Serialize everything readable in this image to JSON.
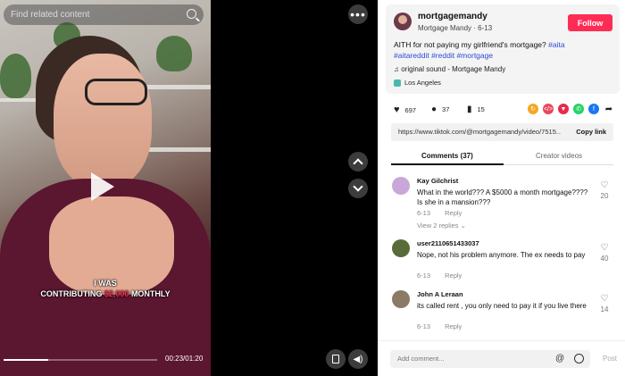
{
  "video": {
    "search_placeholder": "Find related content",
    "caption_line1": "I WAS",
    "caption_line2_pre": "CONTRIBUTING",
    "caption_line2_highlight": "$2,000",
    "caption_line2_post": "MONTHLY",
    "time": "00:23/01:20",
    "progress_fraction": 0.29
  },
  "post": {
    "username": "mortgagemandy",
    "display_name": "Mortgage Mandy · 6-13",
    "follow_label": "Follow",
    "description_text": "AITH for not paying my girlfriend's mortgage?",
    "hashtags": [
      "#aita",
      "#aitareddit",
      "#reddit",
      "#mortgage"
    ],
    "sound": "original sound - Mortgage Mandy",
    "location": "Los Angeles"
  },
  "stats": {
    "likes": "697",
    "comments": "37",
    "saves": "15"
  },
  "share_icons": [
    {
      "name": "repost-icon",
      "color": "#f5a623"
    },
    {
      "name": "embed-icon",
      "color": "#e9455c"
    },
    {
      "name": "send-icon",
      "color": "#e92a4a"
    },
    {
      "name": "whatsapp-icon",
      "color": "#25d366"
    },
    {
      "name": "facebook-icon",
      "color": "#1877f2"
    }
  ],
  "link": {
    "url": "https://www.tiktok.com/@mortgagemandy/video/7515...",
    "copy_label": "Copy link"
  },
  "tabs": {
    "comments": "Comments (37)",
    "creator_videos": "Creator videos"
  },
  "comments": [
    {
      "name": "Kay Gilchrist",
      "text": "What in the world??? A $5000 a month mortgage???? Is she in a mansion???",
      "date": "6-13",
      "reply": "Reply",
      "likes": "20",
      "view_replies": "View 2 replies"
    },
    {
      "name": "user2110651433037",
      "text": "Nope, not his problem anymore. The ex needs to pay",
      "date": "6-13",
      "reply": "Reply",
      "likes": "40"
    },
    {
      "name": "John A Leraan",
      "text": "its called rent , you only need to pay it if you live there",
      "date": "6-13",
      "reply": "Reply",
      "likes": "14"
    }
  ],
  "composer": {
    "placeholder": "Add comment...",
    "post_label": "Post"
  }
}
